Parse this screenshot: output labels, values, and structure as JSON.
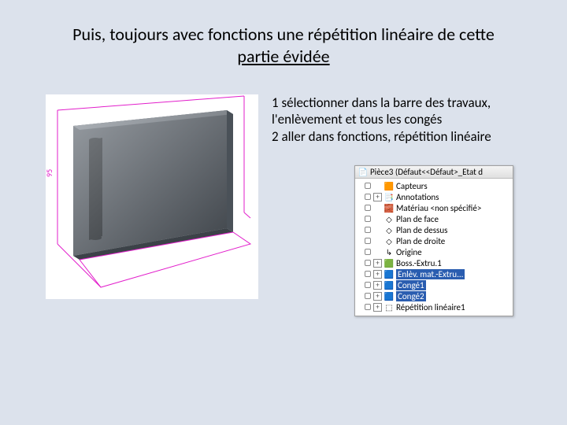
{
  "title_line1": "Puis, toujours avec fonctions une répétition linéaire de cette",
  "title_line2": "partie évidée",
  "body": "1 sélectionner dans la barre des travaux, l'enlèvement et tous les congés\n2 aller dans fonctions, répétition linéaire",
  "cad": {
    "dim_label": "95"
  },
  "tree": {
    "header_icon": "📄",
    "header": "Pièce3 (Défaut<<Défaut>_Etat d",
    "rows": [
      {
        "icon": "🟧",
        "label": "Capteurs",
        "indent": 0,
        "exp": null,
        "sel": false
      },
      {
        "icon": "📑",
        "label": "Annotations",
        "indent": 0,
        "exp": "+",
        "sel": false
      },
      {
        "icon": "🧱",
        "label": "Matériau <non spécifié>",
        "indent": 0,
        "exp": null,
        "sel": false
      },
      {
        "icon": "◇",
        "label": "Plan de face",
        "indent": 0,
        "exp": null,
        "sel": false
      },
      {
        "icon": "◇",
        "label": "Plan de dessus",
        "indent": 0,
        "exp": null,
        "sel": false
      },
      {
        "icon": "◇",
        "label": "Plan de droite",
        "indent": 0,
        "exp": null,
        "sel": false
      },
      {
        "icon": "↳",
        "label": "Origine",
        "indent": 0,
        "exp": null,
        "sel": false
      },
      {
        "icon": "🟩",
        "label": "Boss.-Extru.1",
        "indent": 0,
        "exp": "+",
        "sel": false
      },
      {
        "icon": "🟦",
        "label": "Enlèv. mat.-Extru...",
        "indent": 0,
        "exp": "+",
        "sel": true
      },
      {
        "icon": "🟦",
        "label": "Congé1",
        "indent": 0,
        "exp": "+",
        "sel": true
      },
      {
        "icon": "🟦",
        "label": "Congé2",
        "indent": 0,
        "exp": "+",
        "sel": true
      },
      {
        "icon": "⬚",
        "label": "Répétition linéaire1",
        "indent": 0,
        "exp": "+",
        "sel": false
      }
    ]
  }
}
